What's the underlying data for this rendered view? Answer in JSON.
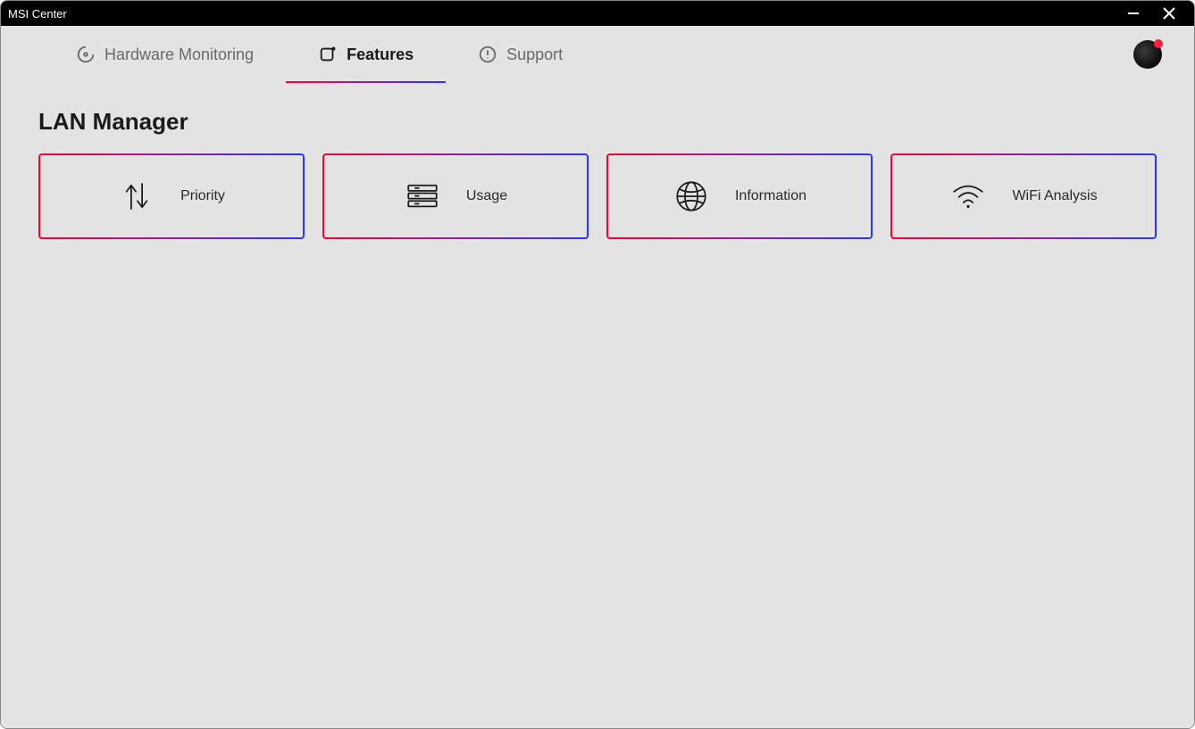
{
  "window": {
    "title": "MSI Center"
  },
  "nav": {
    "tabs": [
      {
        "label": "Hardware Monitoring"
      },
      {
        "label": "Features"
      },
      {
        "label": "Support"
      }
    ],
    "active_index": 1
  },
  "page": {
    "title": "LAN Manager"
  },
  "cards": [
    {
      "label": "Priority",
      "icon": "priority-arrows-icon"
    },
    {
      "label": "Usage",
      "icon": "usage-bars-icon"
    },
    {
      "label": "Information",
      "icon": "globe-icon"
    },
    {
      "label": "WiFi Analysis",
      "icon": "wifi-icon"
    }
  ]
}
